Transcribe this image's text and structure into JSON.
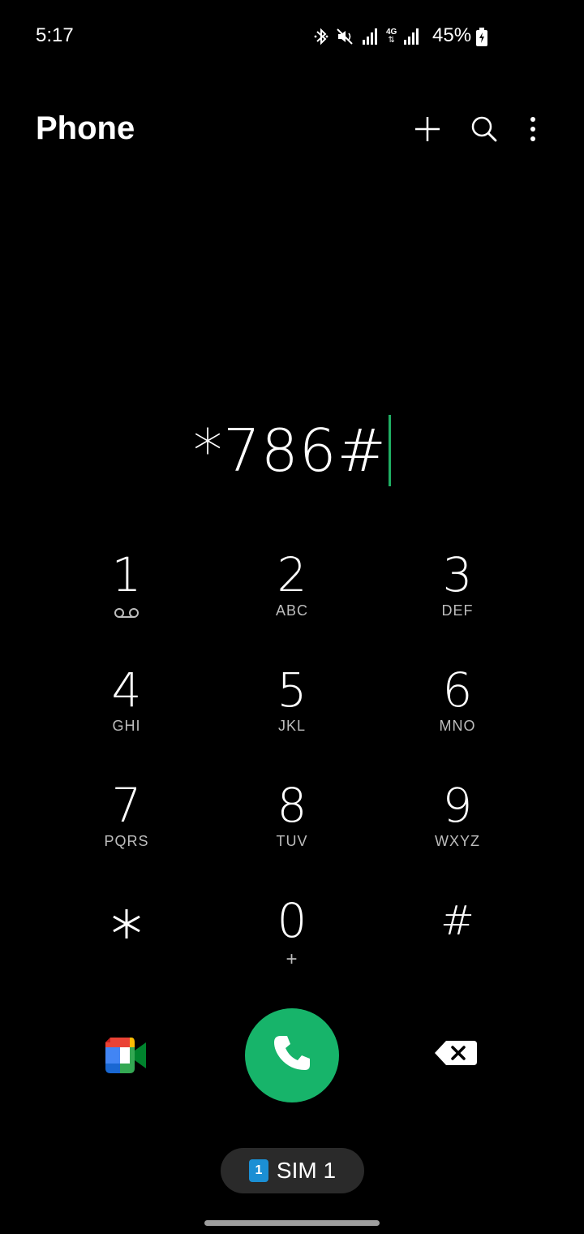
{
  "status_bar": {
    "time": "5:17",
    "battery_percent": "45%",
    "network_type": "4G",
    "icons": [
      "bluetooth-icon",
      "mute-icon",
      "signal-icon",
      "4g-icon",
      "signal-icon",
      "battery-charging-icon"
    ]
  },
  "app_bar": {
    "title": "Phone",
    "actions": [
      "add-icon",
      "search-icon",
      "more-vert-icon"
    ]
  },
  "dialer": {
    "number": "*786#",
    "cursor_color": "#1fae63"
  },
  "keypad": {
    "keys": [
      {
        "digit": "1",
        "letters": "",
        "sub_icon": "voicemail-icon"
      },
      {
        "digit": "2",
        "letters": "ABC"
      },
      {
        "digit": "3",
        "letters": "DEF"
      },
      {
        "digit": "4",
        "letters": "GHI"
      },
      {
        "digit": "5",
        "letters": "JKL"
      },
      {
        "digit": "6",
        "letters": "MNO"
      },
      {
        "digit": "7",
        "letters": "PQRS"
      },
      {
        "digit": "8",
        "letters": "TUV"
      },
      {
        "digit": "9",
        "letters": "WXYZ"
      },
      {
        "digit": "",
        "letters": "",
        "sub_icon": "asterisk-icon"
      },
      {
        "digit": "0",
        "letters": "+"
      },
      {
        "digit": "#",
        "letters": ""
      }
    ]
  },
  "actions": {
    "video_call_icon": "google-meet-icon",
    "call_icon": "phone-icon",
    "call_color": "#17b46a",
    "backspace_icon": "backspace-icon"
  },
  "sim": {
    "badge": "1",
    "label": "SIM 1",
    "badge_color": "#1b8fd4"
  }
}
